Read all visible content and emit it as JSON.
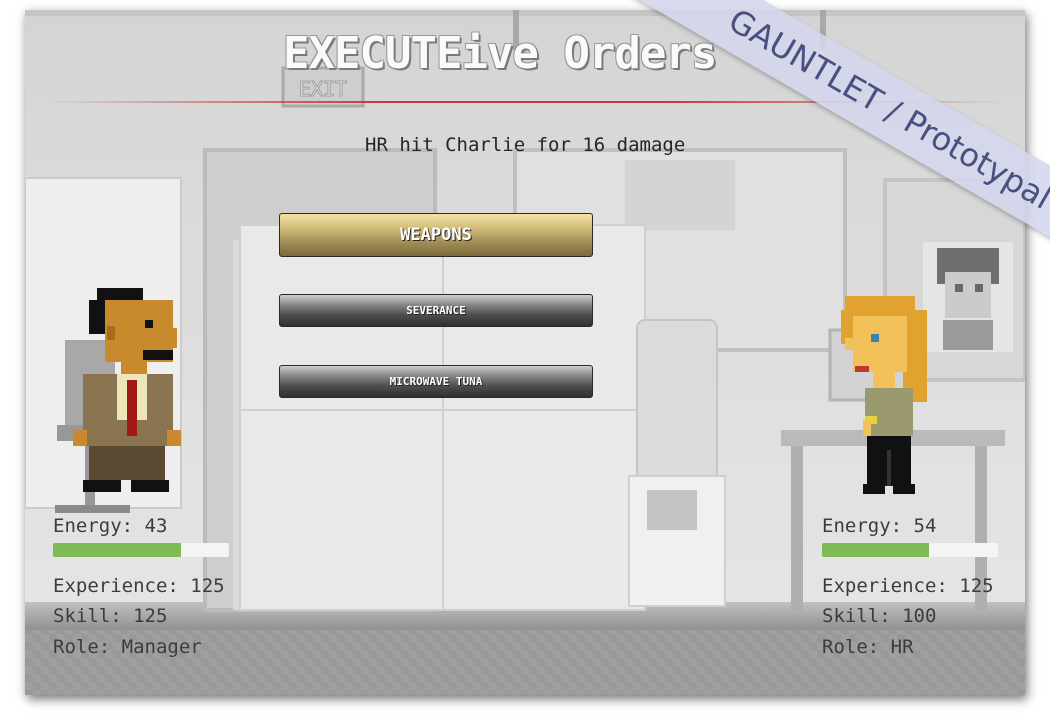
{
  "game": {
    "title": "EXECUTEive Orders",
    "status_message": "HR hit Charlie for 16 damage",
    "banner": "GAUNTLET / Prototypal",
    "menu": {
      "weapons_label": "WEAPONS",
      "options": [
        "SEVERANCE",
        "MICROWAVE TUNA"
      ]
    },
    "player": {
      "energy_label": "Energy: 43",
      "energy_value": 43,
      "energy_fill_fraction": 0.73,
      "experience_label": "Experience: 125",
      "skill_label": "Skill: 125",
      "role_label": "Role: Manager"
    },
    "enemy": {
      "energy_label": "Energy: 54",
      "energy_value": 54,
      "energy_fill_fraction": 0.61,
      "experience_label": "Experience: 125",
      "skill_label": "Skill: 100",
      "role_label": "Role: HR"
    },
    "colors": {
      "energy_bar": "#7dbb57",
      "weapons_button": "#c9b46e",
      "option_button": "#4d4d4d",
      "title_rule": "#c82828",
      "banner": "#d4d6ec"
    },
    "background_signage": [
      "EXIT"
    ]
  }
}
